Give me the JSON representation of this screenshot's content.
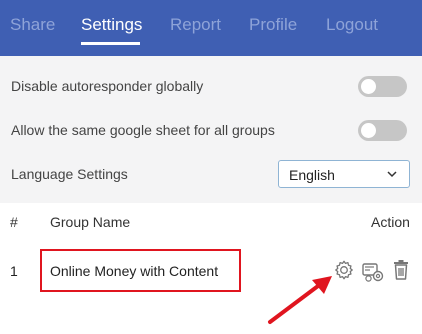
{
  "nav": {
    "tabs": [
      {
        "label": "Share",
        "active": false
      },
      {
        "label": "Settings",
        "active": true
      },
      {
        "label": "Report",
        "active": false
      },
      {
        "label": "Profile",
        "active": false
      },
      {
        "label": "Logout",
        "active": false
      }
    ]
  },
  "settings": {
    "disable_autoresponder": {
      "label": "Disable autoresponder globally",
      "enabled": false
    },
    "same_sheet": {
      "label": "Allow the same google sheet for all groups",
      "enabled": false
    },
    "language": {
      "label": "Language Settings",
      "value": "English"
    }
  },
  "table": {
    "headers": {
      "index": "#",
      "name": "Group Name",
      "action": "Action"
    },
    "rows": [
      {
        "index": "1",
        "name": "Online Money with Content"
      }
    ]
  },
  "icons": {
    "settings": "gear-icon",
    "config": "settings-cogs-icon",
    "delete": "trash-icon",
    "annotation": "red-arrow-annotation"
  },
  "colors": {
    "nav_bg": "#3f5fb3",
    "highlight": "#e0151f",
    "annotation_arrow": "#e0151f"
  }
}
